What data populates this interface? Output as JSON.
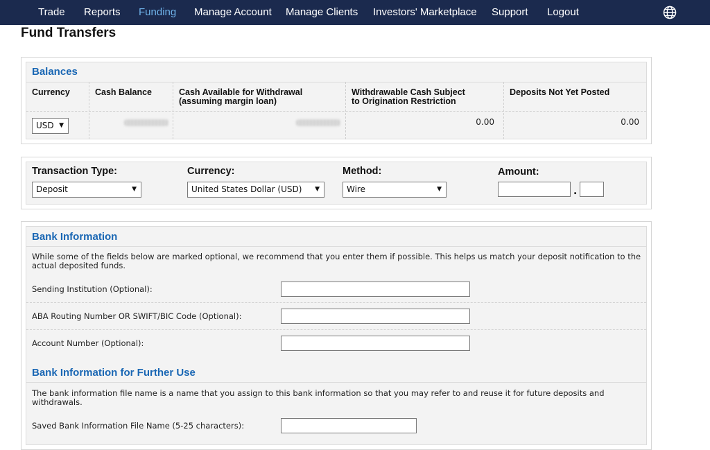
{
  "nav": {
    "items": [
      {
        "label": "Trade",
        "active": false
      },
      {
        "label": "Reports",
        "active": false
      },
      {
        "label": "Funding",
        "active": true
      },
      {
        "label": "Manage Account",
        "active": false
      },
      {
        "label": "Manage Clients",
        "active": false
      },
      {
        "label": "Investors' Marketplace",
        "active": false
      },
      {
        "label": "Support",
        "active": false
      },
      {
        "label": "Logout",
        "active": false
      }
    ],
    "globe_icon": "globe-icon",
    "bg_color": "#1b2a4e",
    "active_color": "#6fb3ea"
  },
  "page": {
    "title": "Fund Transfers"
  },
  "balances": {
    "title": "Balances",
    "headers": {
      "currency": "Currency",
      "cash_balance": "Cash Balance",
      "cash_available_1": "Cash Available for Withdrawal",
      "cash_available_2": "(assuming margin loan)",
      "withdrawable_1": "Withdrawable Cash Subject",
      "withdrawable_2": "to Origination Restriction",
      "deposits": "Deposits Not Yet Posted"
    },
    "row": {
      "currency": "USD",
      "withdrawable": "0.00",
      "deposits": "0.00"
    }
  },
  "transaction": {
    "type_label": "Transaction Type:",
    "type_value": "Deposit",
    "currency_label": "Currency:",
    "currency_value": "United States Dollar (USD)",
    "method_label": "Method:",
    "method_value": "Wire",
    "amount_label": "Amount:",
    "decimal_sep": ".",
    "amount_value": "",
    "cents_value": ""
  },
  "bank": {
    "title": "Bank Information",
    "description": "While some of the fields below are marked optional, we recommend that you enter them if possible. This helps us match your deposit notification to the actual deposited funds.",
    "fields": [
      {
        "label": "Sending Institution (Optional):",
        "value": ""
      },
      {
        "label": "ABA Routing Number OR SWIFT/BIC Code (Optional):",
        "value": ""
      },
      {
        "label": "Account Number (Optional):",
        "value": ""
      }
    ],
    "further_title": "Bank Information for Further Use",
    "further_description": "The bank information file name is a name that you assign to this bank information so that you may refer to and reuse it for future deposits and withdrawals.",
    "file_name_label": "Saved Bank Information File Name (5-25 characters):",
    "file_name_value": ""
  },
  "colors": {
    "section_title": "#1a67b4",
    "panel_bg": "#f3f3f3"
  }
}
